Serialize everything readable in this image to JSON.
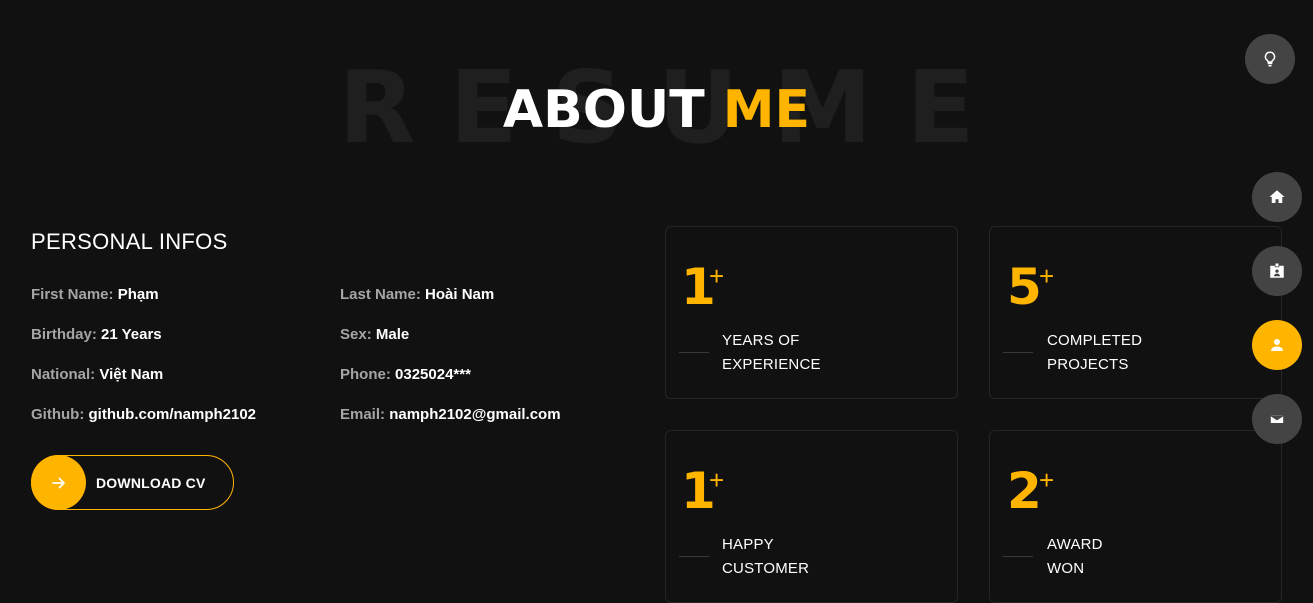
{
  "header": {
    "background_word": "RESUME",
    "title_main": "ABOUT",
    "title_accent": "ME"
  },
  "personal": {
    "heading": "PERSONAL INFOS",
    "fields": [
      {
        "label": "First Name:",
        "value": "Phạm"
      },
      {
        "label": "Last Name:",
        "value": "Hoài Nam"
      },
      {
        "label": "Birthday:",
        "value": "21 Years"
      },
      {
        "label": "Sex:",
        "value": "Male"
      },
      {
        "label": "National:",
        "value": "Việt Nam"
      },
      {
        "label": "Phone:",
        "value": "0325024***"
      },
      {
        "label": "Github:",
        "value": "github.com/namph2102"
      },
      {
        "label": "Email:",
        "value": "namph2102@gmail.com"
      }
    ],
    "download_label": "DOWNLOAD CV",
    "download_icon": "arrow-right-icon"
  },
  "stats": [
    {
      "number": "1",
      "plus": "+",
      "line1": "YEARS OF",
      "line2": "EXPERIENCE"
    },
    {
      "number": "5",
      "plus": "+",
      "line1": "COMPLETED",
      "line2": "PROJECTS"
    },
    {
      "number": "1",
      "plus": "+",
      "line1": "HAPPY",
      "line2": "CUSTOMER"
    },
    {
      "number": "2",
      "plus": "+",
      "line1": "AWARD",
      "line2": "WON"
    }
  ],
  "sidebar": {
    "theme_toggle_icon": "lightbulb-icon",
    "items": [
      {
        "icon": "home-icon",
        "active": false
      },
      {
        "icon": "id-card-icon",
        "active": false
      },
      {
        "icon": "user-icon",
        "active": true
      },
      {
        "icon": "envelope-icon",
        "active": false
      }
    ]
  },
  "colors": {
    "background": "#111111",
    "accent": "#ffb400",
    "box_border": "#252525",
    "side_button": "#2b2a2a"
  }
}
